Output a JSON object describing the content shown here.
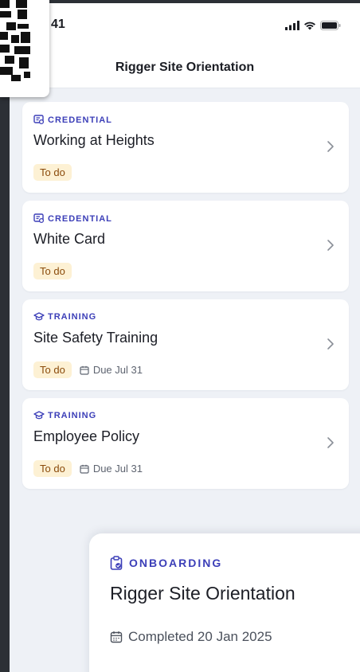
{
  "status_bar": {
    "time": "41"
  },
  "header": {
    "title": "Rigger Site Orientation"
  },
  "cards": [
    {
      "category": "CREDENTIAL",
      "icon": "credential-icon",
      "title": "Working at Heights",
      "status": "To do",
      "due": ""
    },
    {
      "category": "CREDENTIAL",
      "icon": "credential-icon",
      "title": "White Card",
      "status": "To do",
      "due": ""
    },
    {
      "category": "TRAINING",
      "icon": "graduation-cap-icon",
      "title": "Site Safety Training",
      "status": "To do",
      "due": "Due Jul 31"
    },
    {
      "category": "TRAINING",
      "icon": "graduation-cap-icon",
      "title": "Employee Policy",
      "status": "To do",
      "due": "Due Jul 31"
    }
  ],
  "sheet": {
    "category": "ONBOARDING",
    "title": "Rigger Site Orientation",
    "completed": "Completed 20 Jan 2025"
  },
  "colors": {
    "accent": "#3c3fb8",
    "todo_bg": "#fdf1d4",
    "todo_text": "#8a4a0a",
    "page_bg": "#eef1f6"
  }
}
